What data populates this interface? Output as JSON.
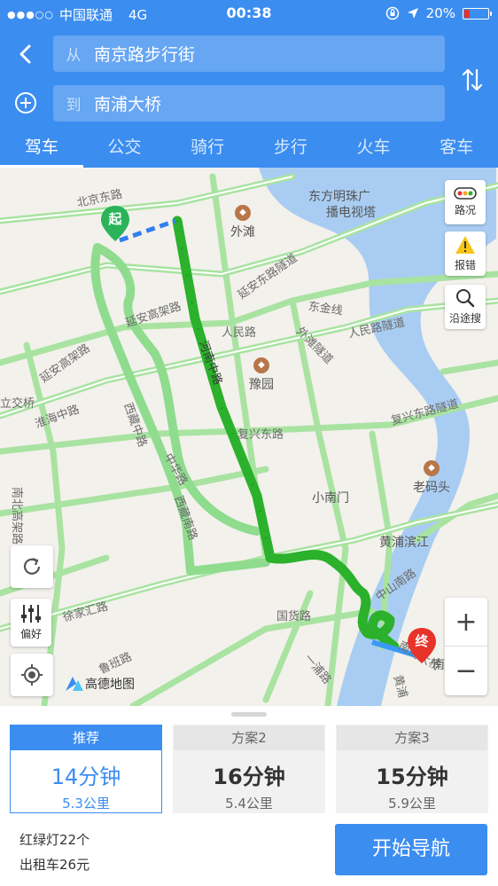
{
  "status_bar": {
    "carrier": "中国联通",
    "network": "4G",
    "time": "00:38",
    "battery": "20%",
    "battery_level": 0.2,
    "battery_color": "#e8332a"
  },
  "search": {
    "from_prefix": "从",
    "from_value": "南京路步行街",
    "to_prefix": "到",
    "to_value": "南浦大桥"
  },
  "tabs": [
    {
      "label": "驾车",
      "active": true
    },
    {
      "label": "公交",
      "active": false
    },
    {
      "label": "骑行",
      "active": false
    },
    {
      "label": "步行",
      "active": false
    },
    {
      "label": "火车",
      "active": false
    },
    {
      "label": "客车",
      "active": false
    }
  ],
  "map": {
    "labels": {
      "beijing_e": "北京东路",
      "waitan": "外滩",
      "dongfang": "东方明珠广",
      "bodian": "播电视塔",
      "yanan_tunnel": "延安东路隧道",
      "yanan_elev1": "延安高架路",
      "yanan_elev2": "延安高架路",
      "dongjin": "东金线",
      "renmin": "人民路",
      "renmin_tunnel": "人民路隧道",
      "waima_tunnel": "外滩隧道",
      "huangpu": "黄浦",
      "henan": "河南中路",
      "yuyuan": "豫园",
      "lijiao": "立交桥",
      "huaihai": "淮海中路",
      "xizang": "西藏中路",
      "fuxing": "复兴东路",
      "fuxing_tunnel": "复兴东路隧道",
      "zhonghua": "中华路",
      "xizang_s": "西藏南路",
      "nanbei": "南北高架路",
      "laomatou": "老码头",
      "xiaonanmen": "小南门",
      "huangpu_riverside": "黄浦滨江",
      "zhongshan_s": "中山南路",
      "xujiahui": "徐家汇路",
      "guohuo": "国货路",
      "luban": "鲁班路",
      "nanpu_bridge": "南浦大桥",
      "nan": "南",
      "huangpu2": "黄浦",
      "yixian": "一浦路",
      "luolu": "路"
    },
    "start_marker": "起",
    "end_marker": "终",
    "btn_traffic": "路况",
    "btn_report": "报错",
    "btn_search": "沿途搜",
    "btn_pref": "偏好",
    "logo": "高德地图",
    "zoom_in": "+",
    "zoom_out": "−"
  },
  "routes": [
    {
      "title": "推荐",
      "time": "14分钟",
      "distance": "5.3公里",
      "active": true
    },
    {
      "title": "方案2",
      "time": "16分钟",
      "distance": "5.4公里",
      "active": false
    },
    {
      "title": "方案3",
      "time": "15分钟",
      "distance": "5.9公里",
      "active": false
    }
  ],
  "summary": {
    "traffic_lights": "红绿灯22个",
    "taxi": "出租车26元"
  },
  "start_button": "开始导航"
}
